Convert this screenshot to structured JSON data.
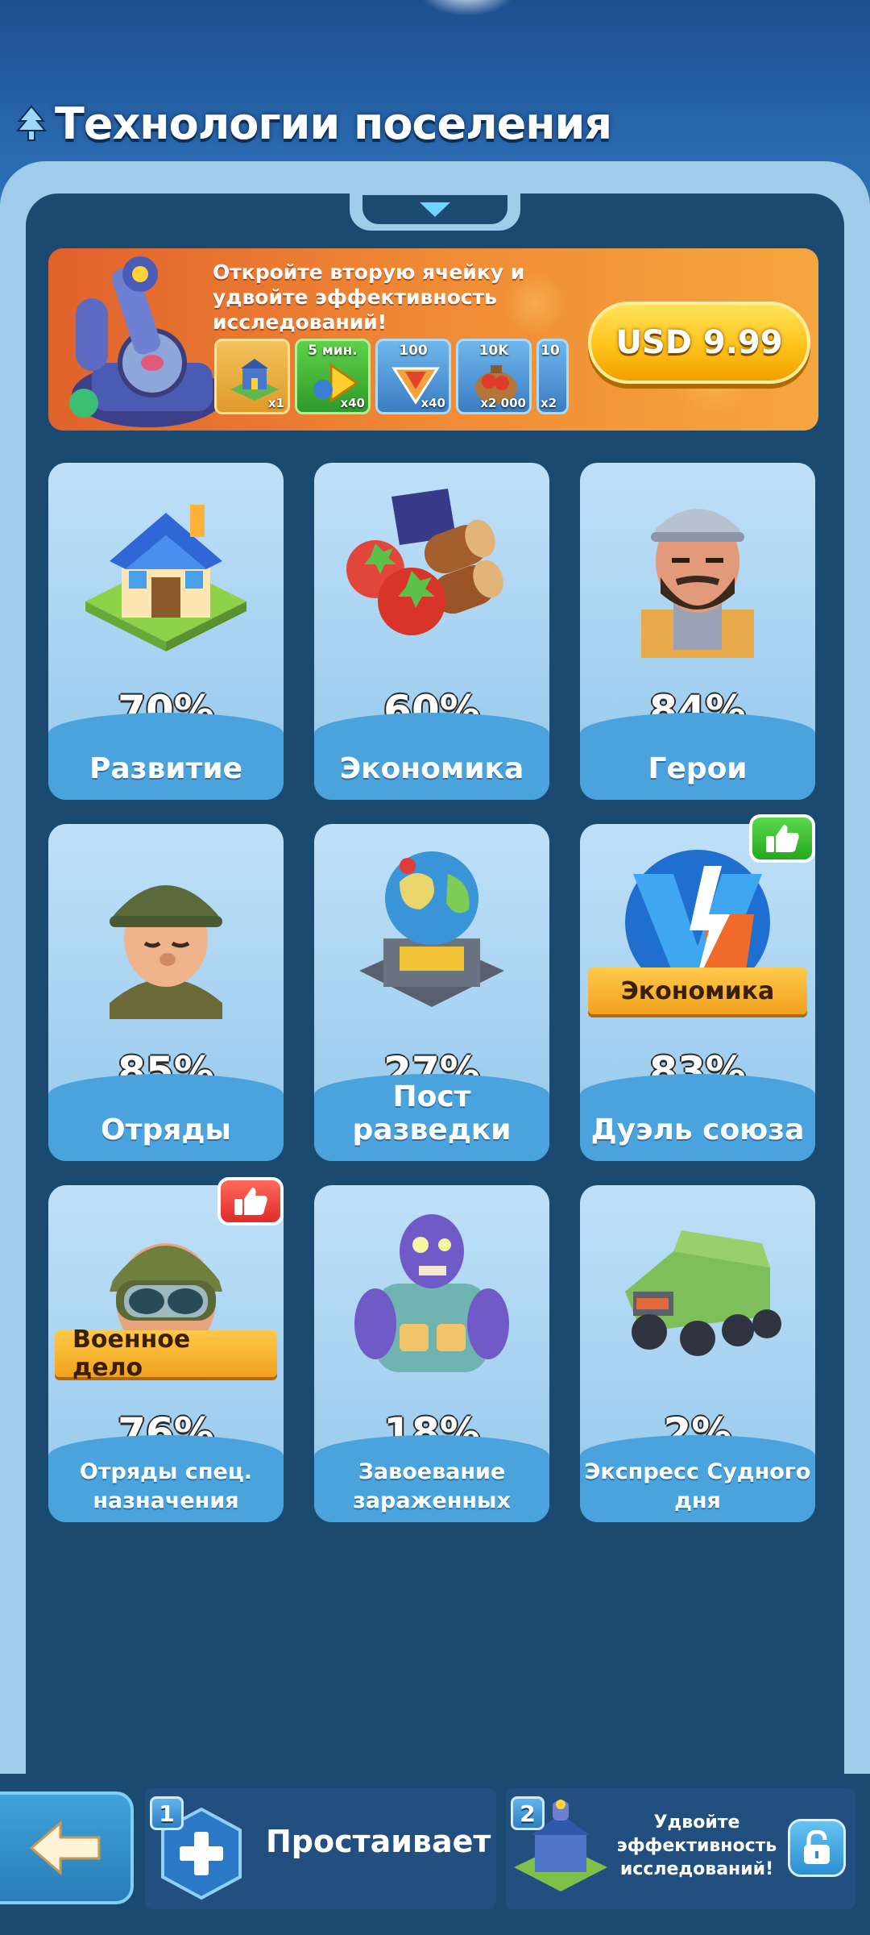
{
  "header": {
    "title": "Технологии поселения"
  },
  "promo": {
    "text": "Откройте вторую ячейку и удвойте эффективность исследований!",
    "price_label": "USD 9.99",
    "items": [
      {
        "icon": "research-building-icon",
        "top": "",
        "qty": "x1",
        "style": "gold"
      },
      {
        "icon": "speedup-icon",
        "top": "5 мин.",
        "qty": "x40",
        "style": "green"
      },
      {
        "icon": "v-gem-icon",
        "top": "100",
        "qty": "x40",
        "style": "blue"
      },
      {
        "icon": "food-sack-icon",
        "top": "10K",
        "qty": "x2 000",
        "style": "blue"
      },
      {
        "icon": "wood-sack-icon",
        "top": "10",
        "qty": "x2",
        "style": "blue"
      }
    ]
  },
  "cards": [
    {
      "id": "development",
      "percent": "70%",
      "label": "Развитие",
      "icon": "house-icon"
    },
    {
      "id": "economy",
      "percent": "60%",
      "label": "Экономика",
      "icon": "resources-icon"
    },
    {
      "id": "heroes",
      "percent": "84%",
      "label": "Герои",
      "icon": "hero-portrait-icon"
    },
    {
      "id": "squads",
      "percent": "85%",
      "label": "Отряды",
      "icon": "soldier-icon"
    },
    {
      "id": "recon-post",
      "percent": "27%",
      "label": "Пост разведки",
      "icon": "globe-radar-icon"
    },
    {
      "id": "alliance-duel",
      "percent": "83%",
      "label": "Дуэль союза",
      "icon": "vs-icon",
      "ribbon": "Экономика",
      "badge": "thumbs-up-icon",
      "badge_color": "#2fb52a"
    },
    {
      "id": "special-forces",
      "percent": "76%",
      "label": "Отряды спец. назначения",
      "icon": "goggles-soldier-icon",
      "ribbon": "Военное дело",
      "badge": "thumbs-up-icon",
      "badge_color": "#e33a33"
    },
    {
      "id": "infected-conquest",
      "percent": "18%",
      "label": "Завоевание зараженных",
      "icon": "zombie-icon"
    },
    {
      "id": "doomsday-express",
      "percent": "2%",
      "label": "Экспресс Судного дня",
      "icon": "armored-truck-icon"
    }
  ],
  "bottom": {
    "slot1": {
      "number": "1",
      "label": "Простаивает"
    },
    "slot2": {
      "number": "2",
      "label": "Удвойте эффективность исследований!"
    }
  },
  "colors": {
    "panel": "#1a4a70",
    "card": "#95c8ec",
    "label_band": "#4aa3dc",
    "price_button": "#ffc21a",
    "promo": "#f08a35"
  }
}
